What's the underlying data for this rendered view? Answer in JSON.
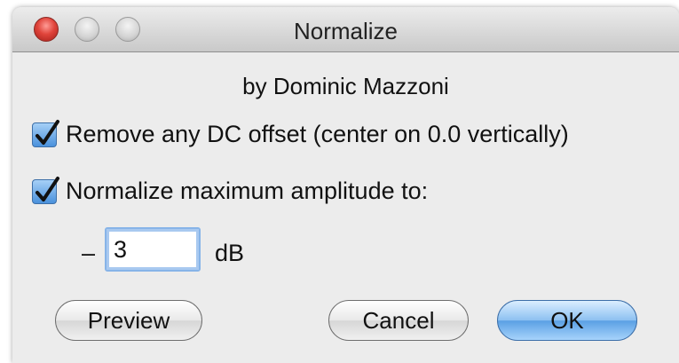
{
  "window": {
    "title": "Normalize",
    "controls": [
      "close-icon",
      "minimize-icon",
      "zoom-icon"
    ]
  },
  "byline": "by Dominic Mazzoni",
  "options": {
    "dc_offset": {
      "label": "Remove any DC offset (center on 0.0 vertically)",
      "checked": true
    },
    "normalize": {
      "label": "Normalize maximum amplitude to:",
      "checked": true
    }
  },
  "amplitude": {
    "sign": "–",
    "value": "3",
    "unit": "dB"
  },
  "buttons": {
    "preview": "Preview",
    "cancel": "Cancel",
    "ok": "OK"
  },
  "colors": {
    "accent": "#4a91dc",
    "close": "#e0443b",
    "default_button": "#5aa0e4"
  }
}
